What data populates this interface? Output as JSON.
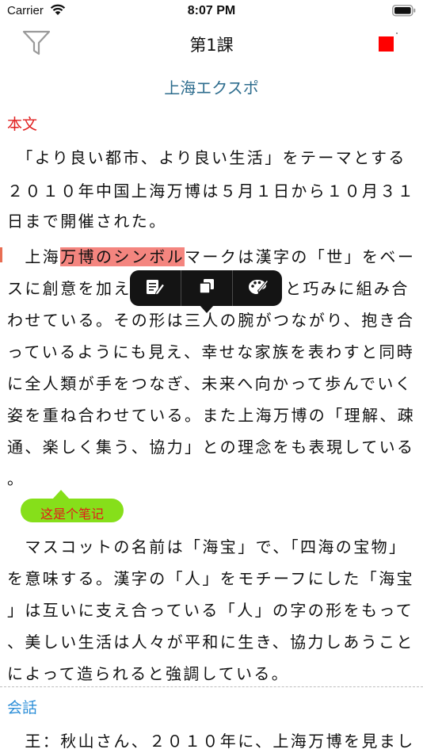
{
  "status_bar": {
    "carrier": "Carrier",
    "time": "8:07 PM"
  },
  "nav": {
    "title": "第1課",
    "left_icon": "filter-icon",
    "record_color": "#ff0000"
  },
  "lesson": {
    "title": "上海エクスポ"
  },
  "sections": {
    "honbun_label": "本文",
    "kaiwa_label": "会話"
  },
  "lines": {
    "l1": "　「より良い都市、より良い生活」をテーマとする",
    "l2": "２０１０年中国上海万博は５月１日から１０月３１",
    "l3": "日まで開催された。",
    "l4_pre": "　上海",
    "l4_hl": "万博のシンボル",
    "l4_post": "マークは漢字の「世」をベー",
    "l5a": "スに創意を加え",
    "l5b": "と巧みに組み合",
    "l6": "わせている。その形は三人の腕がつながり、抱き合",
    "l7": "っているようにも見え、幸せな家族を表わすと同時",
    "l8": "に全人類が手をつなぎ、未来へ向かって歩んでいく",
    "l9": "姿を重ね合わせている。また上海万博の「理解、疎",
    "l10": "通、楽しく集う、協力」との理念をも表現している",
    "l11": "。",
    "l12": "　マスコットの名前は「海宝」で、「四海の宝物」",
    "l13": "を意味する。漢字の「人」をモチーフにした「海宝",
    "l14": "」は互いに支え合っている「人」の字の形をもって",
    "l15": "、美しい生活は人々が平和に生き、協力しあうこと",
    "l16": "によって造られると強調している。",
    "l17": "　王：秋山さん、２０１０年に、上海万博を見まし"
  },
  "note": {
    "text": "这是个笔记",
    "color": "#86df1a"
  },
  "popup": {
    "items": [
      "note-edit-icon",
      "copy-icon",
      "palette-icon"
    ]
  },
  "colors": {
    "highlight": "#f4857f",
    "title_teal": "#2e6d8e",
    "label_red": "#e02020",
    "label_blue": "#2e8fd8"
  }
}
